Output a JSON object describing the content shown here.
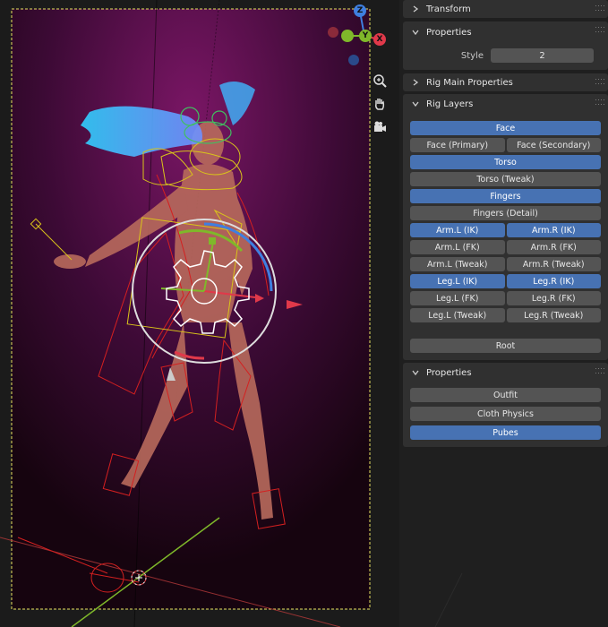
{
  "viewport": {
    "gizmo": {
      "z_label": "Z",
      "y_label": "Y",
      "x_label": "X"
    },
    "colors": {
      "bg_top": "#5a0e48",
      "bg_bottom": "#1a0416",
      "bone_red": "#d42020",
      "bone_yellow": "#d9c41a",
      "axis_x": "#e0394a",
      "axis_y": "#7fb82a",
      "axis_z": "#3f7fe0"
    },
    "nav_tools": [
      "zoom-icon",
      "hand-icon",
      "camera-icon"
    ]
  },
  "sidebar": {
    "transform": {
      "title": "Transform"
    },
    "properties": {
      "title": "Properties",
      "style_label": "Style",
      "style_value": "2"
    },
    "rig_main": {
      "title": "Rig Main Properties"
    },
    "rig_layers": {
      "title": "Rig Layers",
      "face": "Face",
      "face_primary": "Face (Primary)",
      "face_secondary": "Face (Secondary)",
      "torso": "Torso",
      "torso_tweak": "Torso (Tweak)",
      "fingers": "Fingers",
      "fingers_detail": "Fingers (Detail)",
      "arm_l_ik": "Arm.L (IK)",
      "arm_r_ik": "Arm.R (IK)",
      "arm_l_fk": "Arm.L (FK)",
      "arm_r_fk": "Arm.R (FK)",
      "arm_l_tweak": "Arm.L (Tweak)",
      "arm_r_tweak": "Arm.R (Tweak)",
      "leg_l_ik": "Leg.L (IK)",
      "leg_r_ik": "Leg.R (IK)",
      "leg_l_fk": "Leg.L (FK)",
      "leg_r_fk": "Leg.R (FK)",
      "leg_l_tweak": "Leg.L (Tweak)",
      "leg_r_tweak": "Leg.R (Tweak)",
      "root": "Root"
    },
    "properties2": {
      "title": "Properties",
      "outfit": "Outfit",
      "cloth_physics": "Cloth Physics",
      "pubes": "Pubes"
    }
  }
}
